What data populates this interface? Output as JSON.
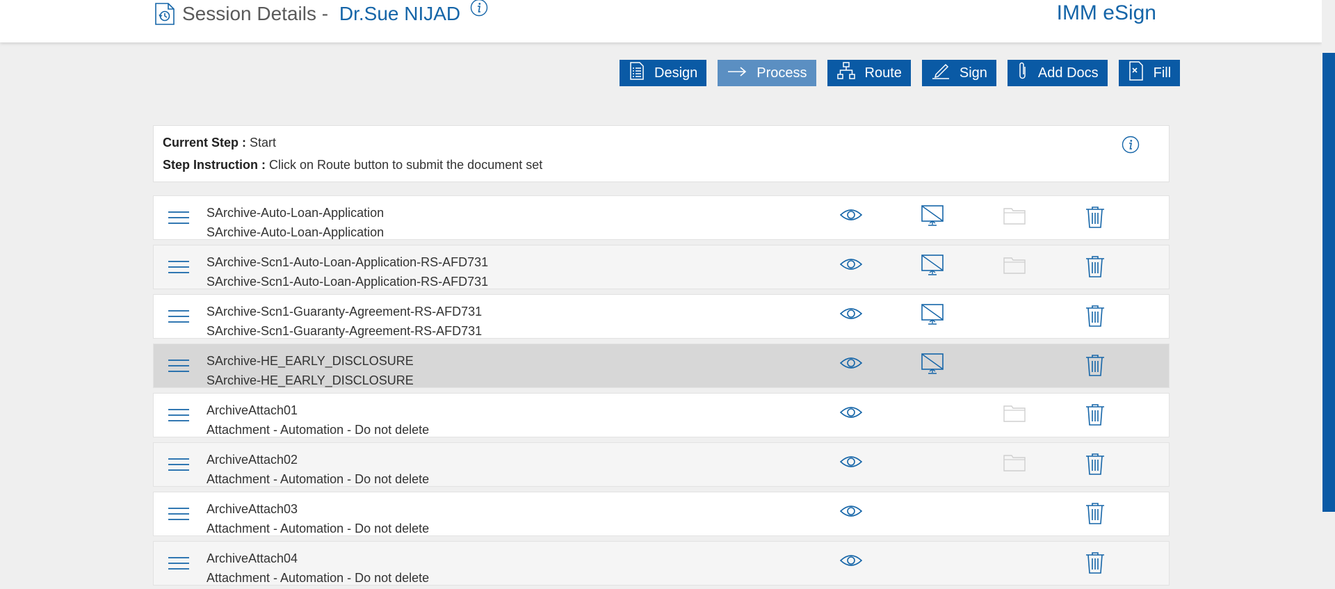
{
  "header": {
    "title": "Session Details - ",
    "user_name": "Dr.Sue NIJAD",
    "brand": "IMM eSign",
    "icons": [
      "session-history-icon",
      "info-icon"
    ]
  },
  "toolbar": {
    "buttons": [
      {
        "label": "Design",
        "icon": "document-list-icon",
        "active": false
      },
      {
        "label": "Process",
        "icon": "arrow-right-icon",
        "active": true
      },
      {
        "label": "Route",
        "icon": "hierarchy-icon",
        "active": false
      },
      {
        "label": "Sign",
        "icon": "pen-icon",
        "active": false
      },
      {
        "label": "Add Docs",
        "icon": "paperclip-icon",
        "active": false
      },
      {
        "label": "Fill",
        "icon": "fill-form-icon",
        "active": false
      }
    ]
  },
  "step": {
    "current_label": "Current Step :",
    "current_value": "Start",
    "instruction_label": "Step Instruction :",
    "instruction_value": "Click on Route button to submit the document set"
  },
  "documents": [
    {
      "name": "SArchive-Auto-Loan-Application",
      "subtitle": "SArchive-Auto-Loan-Application",
      "view": true,
      "screen": true,
      "folder": true,
      "trash": true
    },
    {
      "name": "SArchive-Scn1-Auto-Loan-Application-RS-AFD731",
      "subtitle": "SArchive-Scn1-Auto-Loan-Application-RS-AFD731",
      "view": true,
      "screen": true,
      "folder": true,
      "trash": true
    },
    {
      "name": "SArchive-Scn1-Guaranty-Agreement-RS-AFD731",
      "subtitle": "SArchive-Scn1-Guaranty-Agreement-RS-AFD731",
      "view": true,
      "screen": true,
      "folder": false,
      "trash": true
    },
    {
      "name": "SArchive-HE_EARLY_DISCLOSURE",
      "subtitle": "SArchive-HE_EARLY_DISCLOSURE",
      "view": true,
      "screen": true,
      "folder": false,
      "trash": true,
      "selected": true
    },
    {
      "name": "ArchiveAttach01",
      "subtitle": "Attachment - Automation - Do not delete",
      "view": true,
      "screen": false,
      "folder": true,
      "trash": true
    },
    {
      "name": "ArchiveAttach02",
      "subtitle": "Attachment - Automation - Do not delete",
      "view": true,
      "screen": false,
      "folder": true,
      "trash": true
    },
    {
      "name": "ArchiveAttach03",
      "subtitle": "Attachment - Automation - Do not delete",
      "view": true,
      "screen": false,
      "folder": false,
      "trash": true
    },
    {
      "name": "ArchiveAttach04",
      "subtitle": "Attachment - Automation - Do not delete",
      "view": true,
      "screen": false,
      "folder": false,
      "trash": true
    }
  ],
  "colors": {
    "primary": "#0a5aa5",
    "active_button": "#5b8fc2",
    "brand_text": "#1565a8",
    "selected_row": "#d7d7d7",
    "page_bg": "#efefef"
  }
}
